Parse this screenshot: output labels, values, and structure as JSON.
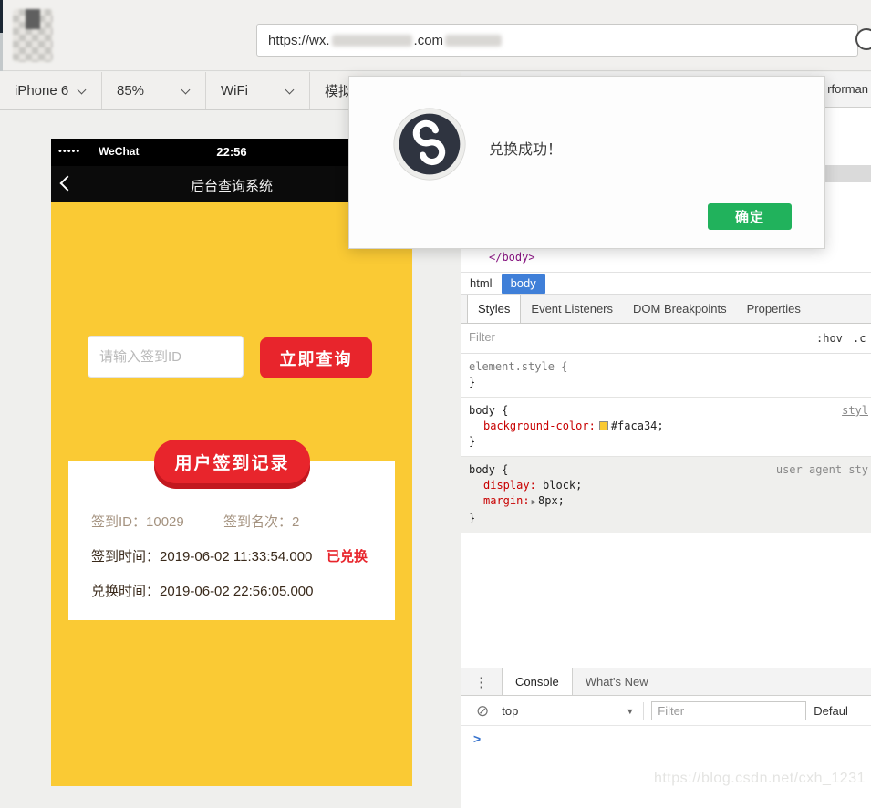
{
  "colors": {
    "phone_yellow": "#faca34",
    "brand_red": "#e8252c",
    "wechat_green": "#21b25c",
    "breadcrumb_blue": "#3f7fd8",
    "swatch_yellow": "#faca34"
  },
  "browser": {
    "url_prefix": "https://wx.",
    "url_mid": ".com"
  },
  "toolbar": {
    "device": "iPhone 6",
    "scale": "85%",
    "network": "WiFi",
    "more_fragment": "模拟操"
  },
  "phone": {
    "status_bar": {
      "signal": "•••••",
      "carrier": "WeChat",
      "time": "22:56"
    },
    "nav_bar": {
      "title": "后台查询系统"
    },
    "query": {
      "input_placeholder": "请输入签到ID",
      "submit_label": "立即查询"
    },
    "record_card": {
      "badge_label": "用户签到记录",
      "row1": [
        {
          "label": "签到ID：",
          "value": "10029"
        },
        {
          "label": "签到名次：",
          "value": "2"
        }
      ],
      "row2": {
        "label": "签到时间：",
        "value": "2019-06-02 11:33:54.000",
        "status": "已兑换"
      },
      "row3": {
        "label": "兑换时间：",
        "value": "2019-06-02 22:56:05.000"
      }
    }
  },
  "modal": {
    "message": "兑换成功！",
    "confirm_label": "确定"
  },
  "devtools": {
    "top_tab_fragment": "rforman",
    "dom_closing_tag": "</body>",
    "breadcrumb": {
      "parent": "html",
      "selected": "body"
    },
    "panel_tabs": [
      "Styles",
      "Event Listeners",
      "DOM Breakpoints",
      "Properties"
    ],
    "styles_filter": {
      "placeholder": "Filter",
      "hov": ":hov",
      "cls": ".c"
    },
    "rule_element_style": {
      "selector": "element.style {",
      "close": "}"
    },
    "rule_body_author": {
      "selector": "body {",
      "prop_name": "background-color:",
      "prop_value": "#faca34;",
      "origin": "styl",
      "close": "}"
    },
    "rule_body_ua": {
      "selector": "body {",
      "origin": "user agent sty",
      "prop1_name": "display:",
      "prop1_value": "block;",
      "prop2_name": "margin:",
      "prop2_arrow": "▶",
      "prop2_value": "8px;",
      "close": "}"
    },
    "console": {
      "menu_icon": "⋮",
      "tab_console": "Console",
      "tab_whats_new": "What's New",
      "clear_icon": "⊘",
      "context": "top",
      "context_arrow": "▼",
      "filter_placeholder": "Filter",
      "levels_fragment": "Defaul",
      "prompt": ">"
    }
  },
  "watermark": "https://blog.csdn.net/cxh_1231"
}
